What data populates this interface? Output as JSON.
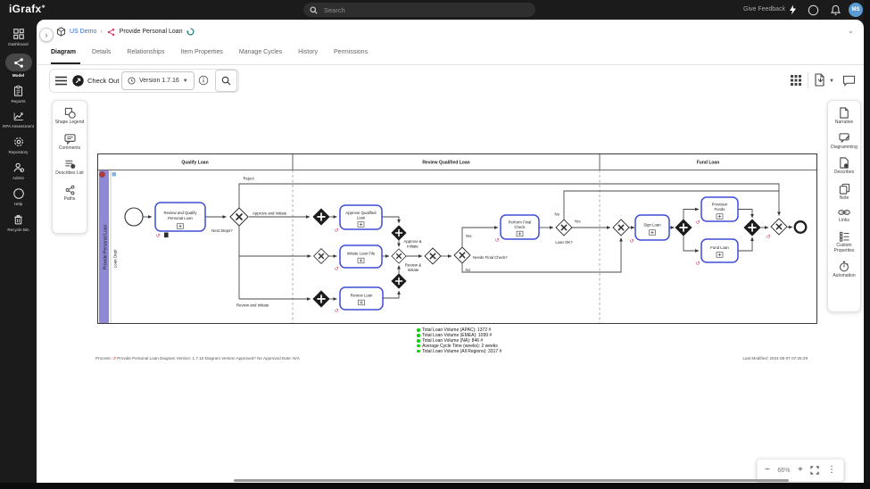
{
  "topbar": {
    "logo": "iGrafx",
    "search_placeholder": "Search",
    "give_feedback": "Give Feedback",
    "avatar_initials": "MS"
  },
  "sidebar": {
    "items": [
      {
        "label": "Dashboard"
      },
      {
        "label": "Model"
      },
      {
        "label": "Reports"
      },
      {
        "label": "RPA Assessment"
      },
      {
        "label": "Repository"
      },
      {
        "label": "Admin"
      },
      {
        "label": "Help"
      },
      {
        "label": "Recycle Bin"
      }
    ]
  },
  "breadcrumb": {
    "root": "US Demo",
    "separator": "›",
    "current": "Provide Personal Loan"
  },
  "tabs": [
    {
      "label": "Diagram"
    },
    {
      "label": "Details"
    },
    {
      "label": "Relationships"
    },
    {
      "label": "Item Properties"
    },
    {
      "label": "Manage Cycles"
    },
    {
      "label": "History"
    },
    {
      "label": "Permissions"
    }
  ],
  "toolbar": {
    "checkout_label": "Check Out",
    "version_label": "Version 1.7.16"
  },
  "left_tools": [
    {
      "label": "Shape Legend"
    },
    {
      "label": "Comments"
    },
    {
      "label": "Describes List"
    },
    {
      "label": "Paths"
    }
  ],
  "right_tools": [
    {
      "label": "Narrative"
    },
    {
      "label": "Diagramming"
    },
    {
      "label": "Describes"
    },
    {
      "label": "Note"
    },
    {
      "label": "Links"
    },
    {
      "label": "Custom Properties"
    },
    {
      "label": "Automation"
    }
  ],
  "diagram": {
    "pool_label": "Provide Personal Loan",
    "lane_label": "Loan Dept",
    "phases": {
      "p1": "Qualify Loan",
      "p2": "Review Qualified Loan",
      "p3": "Fund Loan"
    },
    "nodes": {
      "task1_l1": "Review and Qualify",
      "task1_l2": "Personal Loan",
      "task2_l1": "Approve Qualified",
      "task2_l2": "Loan",
      "task3": "Initiate Loan File",
      "task4": "Review Loan",
      "task5_l1": "Perform Final",
      "task5_l2": "Check",
      "task6": "Sign Loan",
      "task7_l1": "Provision",
      "task7_l2": "Funds",
      "task8": "Fund Loan"
    },
    "edges": {
      "reject": "Reject",
      "approve_and_initiate": "Approve and Initiate",
      "next_steps": "Next Steps?",
      "review_and_initiate": "Review and Initiate",
      "approve_init_l1": "Approve &",
      "approve_init_l2": "Initiate",
      "review_init_l1": "Review &",
      "review_init_l2": "Initiate",
      "yes_check": "Yes",
      "no_check": "No",
      "needs_final_check": "Needs Final Check?",
      "loan_ok": "Loan OK?",
      "no_ok": "No",
      "yes_ok": "Yes"
    },
    "stats": [
      {
        "label": "Total Loan Volume (APAC): 1372 #"
      },
      {
        "label": "Total Loan Volume (EMEA): 1099 #"
      },
      {
        "label": "Total Loan Volume (NA): 846 #"
      },
      {
        "label": "Average Cycle Time (weeks): 2 weeks"
      },
      {
        "label": "Total Loan Volume (All Regions): 3317 #"
      }
    ],
    "footer": {
      "prefix": "Process:",
      "left": "Provide Personal Loan   Diagram Version: 1.7.16   Diagram Version Approved? No   Approved Date: N/A",
      "right": "Last Modified: 2024-05-07 07:26:29"
    }
  },
  "zoom_controls": {
    "zoom_out": "−",
    "level": "66%",
    "zoom_in": "+"
  },
  "colors": {
    "task_border": "#3f4dd8",
    "pool_band": "#8f88d4",
    "stat_dot": "#00d500",
    "accent_pink": "#d6336c",
    "link_blue": "#2f6bd8"
  }
}
